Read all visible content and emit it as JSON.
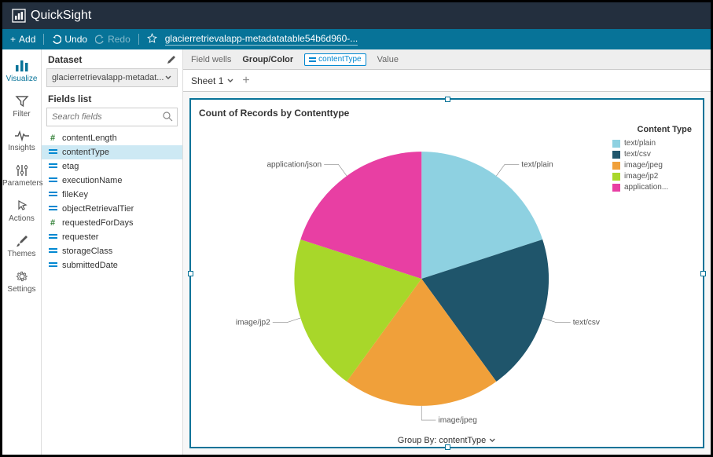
{
  "app": {
    "name": "QuickSight"
  },
  "toolbar": {
    "add": "Add",
    "undo": "Undo",
    "redo": "Redo",
    "doc_name": "glacierretrievalapp-metadatatable54b6d960-..."
  },
  "rail": [
    {
      "label": "Visualize",
      "icon": "bars"
    },
    {
      "label": "Filter",
      "icon": "funnel"
    },
    {
      "label": "Insights",
      "icon": "pulse"
    },
    {
      "label": "Parameters",
      "icon": "sliders"
    },
    {
      "label": "Actions",
      "icon": "pointer"
    },
    {
      "label": "Themes",
      "icon": "brush"
    },
    {
      "label": "Settings",
      "icon": "gear"
    }
  ],
  "sidepanel": {
    "dataset_label": "Dataset",
    "dataset_value": "glacierretrievalapp-metadat...",
    "fields_label": "Fields list",
    "search_placeholder": "Search fields"
  },
  "fields": [
    {
      "name": "contentLength",
      "type": "num"
    },
    {
      "name": "contentType",
      "type": "str",
      "selected": true
    },
    {
      "name": "etag",
      "type": "str"
    },
    {
      "name": "executionName",
      "type": "str"
    },
    {
      "name": "fileKey",
      "type": "str"
    },
    {
      "name": "objectRetrievalTier",
      "type": "str"
    },
    {
      "name": "requestedForDays",
      "type": "num"
    },
    {
      "name": "requester",
      "type": "str"
    },
    {
      "name": "storageClass",
      "type": "str"
    },
    {
      "name": "submittedDate",
      "type": "str"
    }
  ],
  "wells": {
    "label": "Field wells",
    "group_label": "Group/Color",
    "group_value": "contentType",
    "value_label": "Value"
  },
  "tabs": {
    "sheet1": "Sheet 1"
  },
  "viz": {
    "title": "Count of Records by Contenttype",
    "legend_title": "Content Type",
    "groupby_label": "Group By: contentType"
  },
  "chart_data": {
    "type": "pie",
    "title": "Count of Records by Contenttype",
    "series": [
      {
        "name": "text/plain",
        "legend": "text/plain",
        "value": 20,
        "color": "#8ed1e1"
      },
      {
        "name": "text/csv",
        "legend": "text/csv",
        "value": 20,
        "color": "#1f556b"
      },
      {
        "name": "image/jpeg",
        "legend": "image/jpeg",
        "value": 20,
        "color": "#f0a03a"
      },
      {
        "name": "image/jp2",
        "legend": "image/jp2",
        "value": 20,
        "color": "#a8d72a"
      },
      {
        "name": "application/json",
        "legend": "application...",
        "value": 20,
        "color": "#e83fa3"
      }
    ]
  }
}
